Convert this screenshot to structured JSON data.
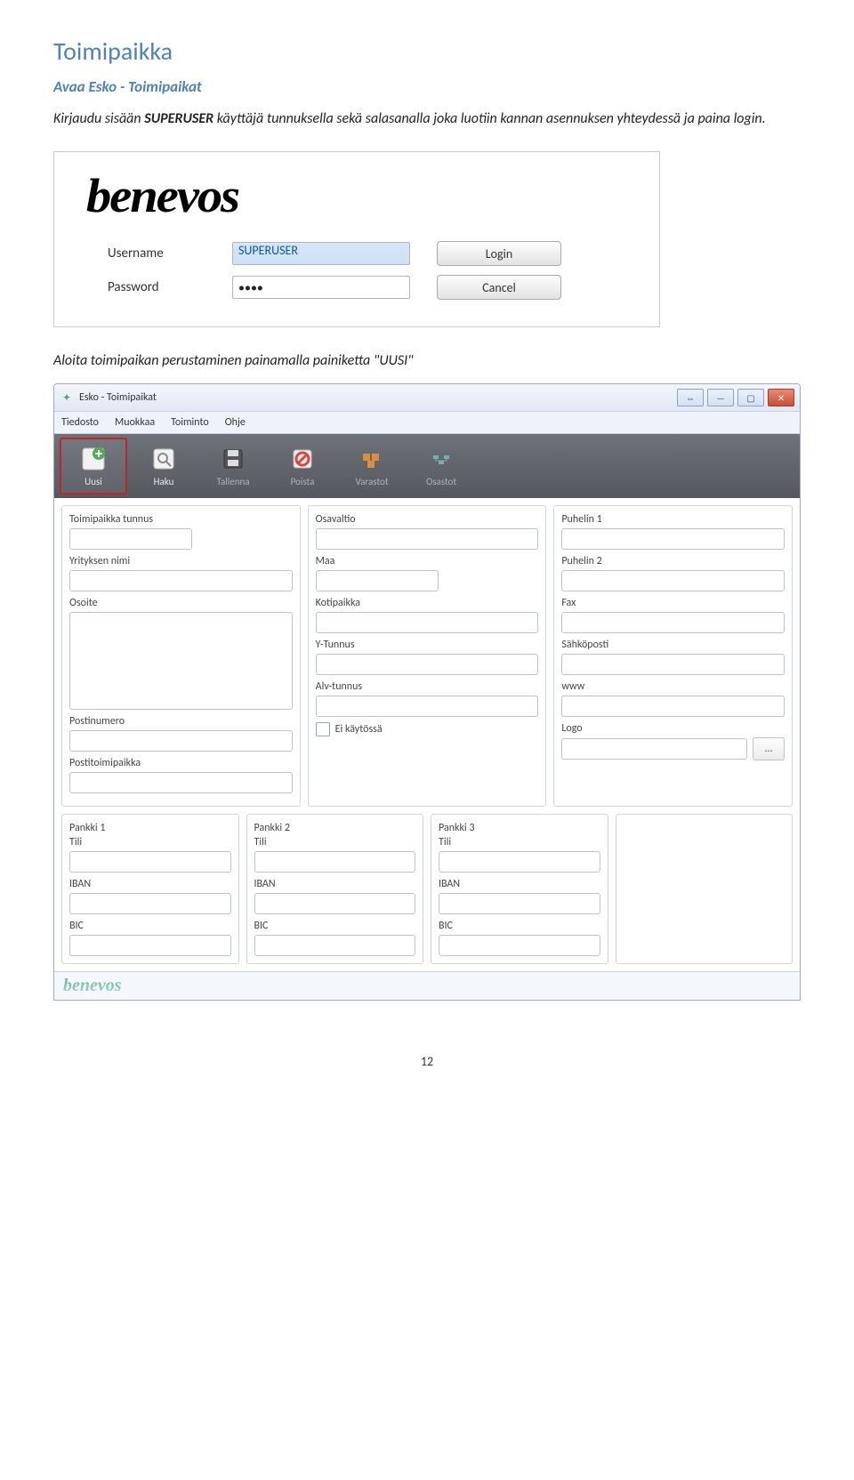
{
  "section_title": "Toimipaikka",
  "subtitle": "Avaa  Esko - Toimipaikat",
  "instruction_prefix": "Kirjaudu sisään ",
  "instruction_bold": "SUPERUSER",
  "instruction_suffix": " käyttäjä tunnuksella sekä salasanalla joka luotiin kannan asennuksen yhteydessä ja paina login.",
  "instruction2": "Aloita toimipaikan perustaminen painamalla painiketta \"UUSI\"",
  "login": {
    "logo": "benevos",
    "username_label": "Username",
    "username_value": "SUPERUSER",
    "password_label": "Password",
    "password_value": "••••",
    "login_btn": "Login",
    "cancel_btn": "Cancel"
  },
  "app": {
    "title": "Esko - Toimipaikat",
    "menu": [
      "Tiedosto",
      "Muokkaa",
      "Toiminto",
      "Ohje"
    ],
    "toolbar": [
      {
        "name": "uusi",
        "label": "Uusi",
        "highlight": true
      },
      {
        "name": "haku",
        "label": "Haku"
      },
      {
        "name": "tallenna",
        "label": "Tallenna",
        "disabled": true
      },
      {
        "name": "poista",
        "label": "Poista",
        "disabled": true
      },
      {
        "name": "varastot",
        "label": "Varastot",
        "disabled": true
      },
      {
        "name": "osastot",
        "label": "Osastot",
        "disabled": true
      }
    ],
    "col1": {
      "toimipaikka_tunnus": "Toimipaikka tunnus",
      "yrityksen_nimi": "Yrityksen nimi",
      "osoite": "Osoite",
      "postinumero": "Postinumero",
      "postitoimipaikka": "Postitoimipaikka"
    },
    "col2": {
      "osavaltio": "Osavaltio",
      "maa": "Maa",
      "kotipaikka": "Kotipaikka",
      "ytunnus": "Y-Tunnus",
      "alvtunnus": "Alv-tunnus",
      "ei_kaytossa": "Ei käytössä"
    },
    "col3": {
      "puhelin1": "Puhelin 1",
      "puhelin2": "Puhelin 2",
      "fax": "Fax",
      "sahkoposti": "Sähköposti",
      "www": "www",
      "logo": "Logo",
      "browse": "..."
    },
    "banks": [
      {
        "title": "Pankki 1",
        "tili": "Tili",
        "iban": "IBAN",
        "bic": "BIC"
      },
      {
        "title": "Pankki 2",
        "tili": "Tili",
        "iban": "IBAN",
        "bic": "BIC"
      },
      {
        "title": "Pankki 3",
        "tili": "Tili",
        "iban": "IBAN",
        "bic": "BIC"
      }
    ],
    "footer_logo": "benevos"
  },
  "page_number": "12"
}
